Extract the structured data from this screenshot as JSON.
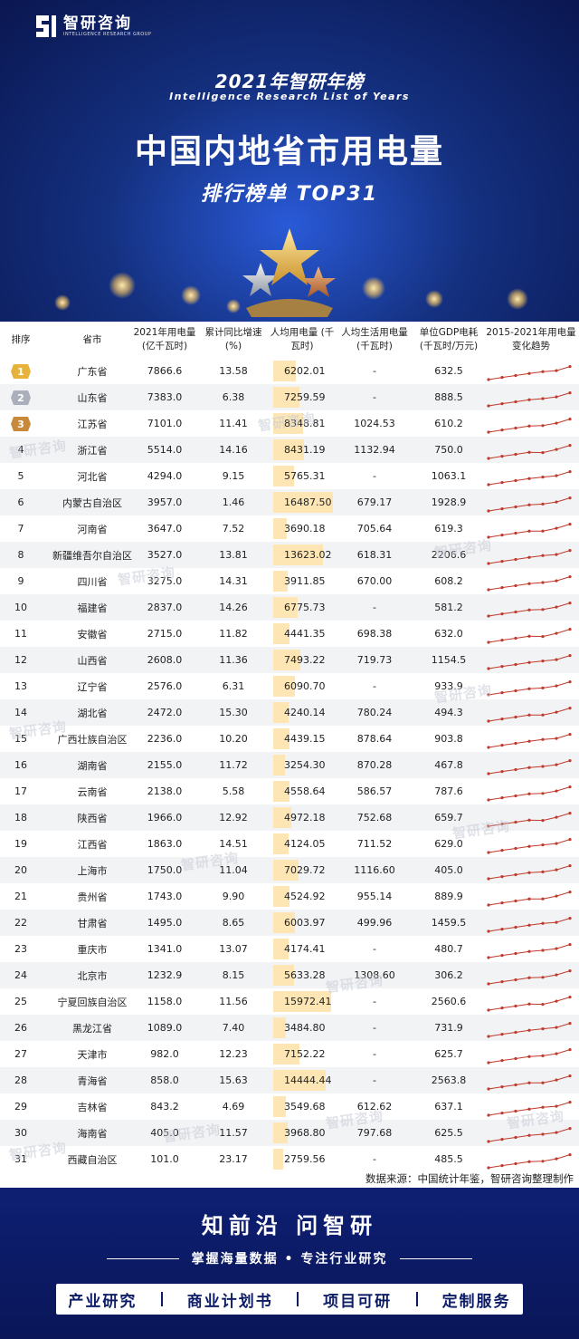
{
  "brand": {
    "name_cn": "智研咨询",
    "name_en": "INTELLIGENCE RESEARCH GROUP"
  },
  "header": {
    "year_title": "2021年智研年榜",
    "en_title": "Intelligence Research List of Years",
    "main_title": "中国内地省市用电量",
    "subtitle": "排行榜单  TOP31"
  },
  "table": {
    "columns": [
      {
        "key": "rank",
        "label": "排序"
      },
      {
        "key": "province",
        "label": "省市"
      },
      {
        "key": "usage",
        "label": "2021年用电量 (亿千瓦时)"
      },
      {
        "key": "growth",
        "label": "累计同比增速 (%)"
      },
      {
        "key": "per_capita",
        "label": "人均用电量 (千瓦时)"
      },
      {
        "key": "residential",
        "label": "人均生活用电量 (千瓦时)"
      },
      {
        "key": "gdp_intensity",
        "label": "单位GDP电耗 (千瓦时/万元)"
      },
      {
        "key": "trend",
        "label": "2015-2021年用电量 变化趋势"
      }
    ],
    "rows": [
      {
        "rank": "1",
        "province": "广东省",
        "usage": "7866.6",
        "growth": "13.58",
        "per_capita": "6202.01",
        "residential": "-",
        "gdp_intensity": "632.5"
      },
      {
        "rank": "2",
        "province": "山东省",
        "usage": "7383.0",
        "growth": "6.38",
        "per_capita": "7259.59",
        "residential": "-",
        "gdp_intensity": "888.5"
      },
      {
        "rank": "3",
        "province": "江苏省",
        "usage": "7101.0",
        "growth": "11.41",
        "per_capita": "8348.81",
        "residential": "1024.53",
        "gdp_intensity": "610.2"
      },
      {
        "rank": "4",
        "province": "浙江省",
        "usage": "5514.0",
        "growth": "14.16",
        "per_capita": "8431.19",
        "residential": "1132.94",
        "gdp_intensity": "750.0"
      },
      {
        "rank": "5",
        "province": "河北省",
        "usage": "4294.0",
        "growth": "9.15",
        "per_capita": "5765.31",
        "residential": "-",
        "gdp_intensity": "1063.1"
      },
      {
        "rank": "6",
        "province": "内蒙古自治区",
        "usage": "3957.0",
        "growth": "1.46",
        "per_capita": "16487.50",
        "residential": "679.17",
        "gdp_intensity": "1928.9"
      },
      {
        "rank": "7",
        "province": "河南省",
        "usage": "3647.0",
        "growth": "7.52",
        "per_capita": "3690.18",
        "residential": "705.64",
        "gdp_intensity": "619.3"
      },
      {
        "rank": "8",
        "province": "新疆维吾尔自治区",
        "usage": "3527.0",
        "growth": "13.81",
        "per_capita": "13623.02",
        "residential": "618.31",
        "gdp_intensity": "2206.6"
      },
      {
        "rank": "9",
        "province": "四川省",
        "usage": "3275.0",
        "growth": "14.31",
        "per_capita": "3911.85",
        "residential": "670.00",
        "gdp_intensity": "608.2"
      },
      {
        "rank": "10",
        "province": "福建省",
        "usage": "2837.0",
        "growth": "14.26",
        "per_capita": "6775.73",
        "residential": "-",
        "gdp_intensity": "581.2"
      },
      {
        "rank": "11",
        "province": "安徽省",
        "usage": "2715.0",
        "growth": "11.82",
        "per_capita": "4441.35",
        "residential": "698.38",
        "gdp_intensity": "632.0"
      },
      {
        "rank": "12",
        "province": "山西省",
        "usage": "2608.0",
        "growth": "11.36",
        "per_capita": "7493.22",
        "residential": "719.73",
        "gdp_intensity": "1154.5"
      },
      {
        "rank": "13",
        "province": "辽宁省",
        "usage": "2576.0",
        "growth": "6.31",
        "per_capita": "6090.70",
        "residential": "-",
        "gdp_intensity": "933.9"
      },
      {
        "rank": "14",
        "province": "湖北省",
        "usage": "2472.0",
        "growth": "15.30",
        "per_capita": "4240.14",
        "residential": "780.24",
        "gdp_intensity": "494.3"
      },
      {
        "rank": "15",
        "province": "广西壮族自治区",
        "usage": "2236.0",
        "growth": "10.20",
        "per_capita": "4439.15",
        "residential": "878.64",
        "gdp_intensity": "903.8"
      },
      {
        "rank": "16",
        "province": "湖南省",
        "usage": "2155.0",
        "growth": "11.72",
        "per_capita": "3254.30",
        "residential": "870.28",
        "gdp_intensity": "467.8"
      },
      {
        "rank": "17",
        "province": "云南省",
        "usage": "2138.0",
        "growth": "5.58",
        "per_capita": "4558.64",
        "residential": "586.57",
        "gdp_intensity": "787.6"
      },
      {
        "rank": "18",
        "province": "陕西省",
        "usage": "1966.0",
        "growth": "12.92",
        "per_capita": "4972.18",
        "residential": "752.68",
        "gdp_intensity": "659.7"
      },
      {
        "rank": "19",
        "province": "江西省",
        "usage": "1863.0",
        "growth": "14.51",
        "per_capita": "4124.05",
        "residential": "711.52",
        "gdp_intensity": "629.0"
      },
      {
        "rank": "20",
        "province": "上海市",
        "usage": "1750.0",
        "growth": "11.04",
        "per_capita": "7029.72",
        "residential": "1116.60",
        "gdp_intensity": "405.0"
      },
      {
        "rank": "21",
        "province": "贵州省",
        "usage": "1743.0",
        "growth": "9.90",
        "per_capita": "4524.92",
        "residential": "955.14",
        "gdp_intensity": "889.9"
      },
      {
        "rank": "22",
        "province": "甘肃省",
        "usage": "1495.0",
        "growth": "8.65",
        "per_capita": "6003.97",
        "residential": "499.96",
        "gdp_intensity": "1459.5"
      },
      {
        "rank": "23",
        "province": "重庆市",
        "usage": "1341.0",
        "growth": "13.07",
        "per_capita": "4174.41",
        "residential": "-",
        "gdp_intensity": "480.7"
      },
      {
        "rank": "24",
        "province": "北京市",
        "usage": "1232.9",
        "growth": "8.15",
        "per_capita": "5633.28",
        "residential": "1308.60",
        "gdp_intensity": "306.2"
      },
      {
        "rank": "25",
        "province": "宁夏回族自治区",
        "usage": "1158.0",
        "growth": "11.56",
        "per_capita": "15972.41",
        "residential": "-",
        "gdp_intensity": "2560.6"
      },
      {
        "rank": "26",
        "province": "黑龙江省",
        "usage": "1089.0",
        "growth": "7.40",
        "per_capita": "3484.80",
        "residential": "-",
        "gdp_intensity": "731.9"
      },
      {
        "rank": "27",
        "province": "天津市",
        "usage": "982.0",
        "growth": "12.23",
        "per_capita": "7152.22",
        "residential": "-",
        "gdp_intensity": "625.7"
      },
      {
        "rank": "28",
        "province": "青海省",
        "usage": "858.0",
        "growth": "15.63",
        "per_capita": "14444.44",
        "residential": "-",
        "gdp_intensity": "2563.8"
      },
      {
        "rank": "29",
        "province": "吉林省",
        "usage": "843.2",
        "growth": "4.69",
        "per_capita": "3549.68",
        "residential": "612.62",
        "gdp_intensity": "637.1"
      },
      {
        "rank": "30",
        "province": "海南省",
        "usage": "405.0",
        "growth": "11.57",
        "per_capita": "3968.80",
        "residential": "797.68",
        "gdp_intensity": "625.5"
      },
      {
        "rank": "31",
        "province": "西藏自治区",
        "usage": "101.0",
        "growth": "23.17",
        "per_capita": "2759.56",
        "residential": "-",
        "gdp_intensity": "485.5"
      }
    ]
  },
  "source": "数据来源：中国统计年鉴，智研咨询整理制作",
  "footer": {
    "slogan": "知前沿  问智研",
    "tagline": "掌握海量数据 • 专注行业研究",
    "services": [
      "产业研究",
      "商业计划书",
      "项目可研",
      "定制服务"
    ]
  },
  "colors": {
    "navy": "#0b1a5e",
    "bar_fill": "#fde6b4",
    "sparkline": "#c0392b",
    "gold": "#e6b23a",
    "silver": "#a9b0bc",
    "bronze": "#c78a3b"
  },
  "chart_data": {
    "type": "table",
    "title": "中国内地省市用电量",
    "bar_column": "per_capita",
    "bar_max": 16487.5
  }
}
